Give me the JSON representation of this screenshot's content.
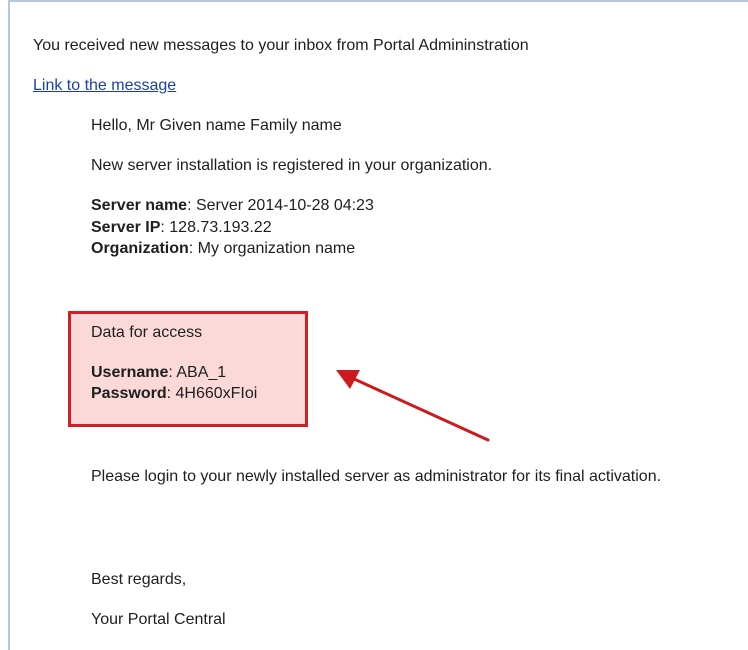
{
  "email": {
    "intro": "You received new messages to your inbox from Portal Admininstration",
    "link_text": "Link to the message",
    "greeting": "Hello, Mr Given name Family name",
    "notice": "New server installation is registered in your organization.",
    "server": {
      "name_label": "Server name",
      "name_value": ": Server 2014-10-28 04:23",
      "ip_label": "Server IP",
      "ip_value": ": 128.73.193.22",
      "org_label": "Organization",
      "org_value": ": My organization name"
    },
    "access": {
      "heading": "Data for access",
      "username_label": "Username",
      "username_value": ": ABA_1",
      "password_label": "Password",
      "password_value": ": 4H660xFIoi"
    },
    "instruction": "Please login to your newly installed server as administrator for its final activation.",
    "closing": "Best regards,",
    "signature": "Your Portal Central"
  },
  "colors": {
    "link": "#1a3fa8",
    "highlight_border": "#d11f26",
    "highlight_fill": "#fbd9d9",
    "arrow": "#cc1a1f"
  }
}
